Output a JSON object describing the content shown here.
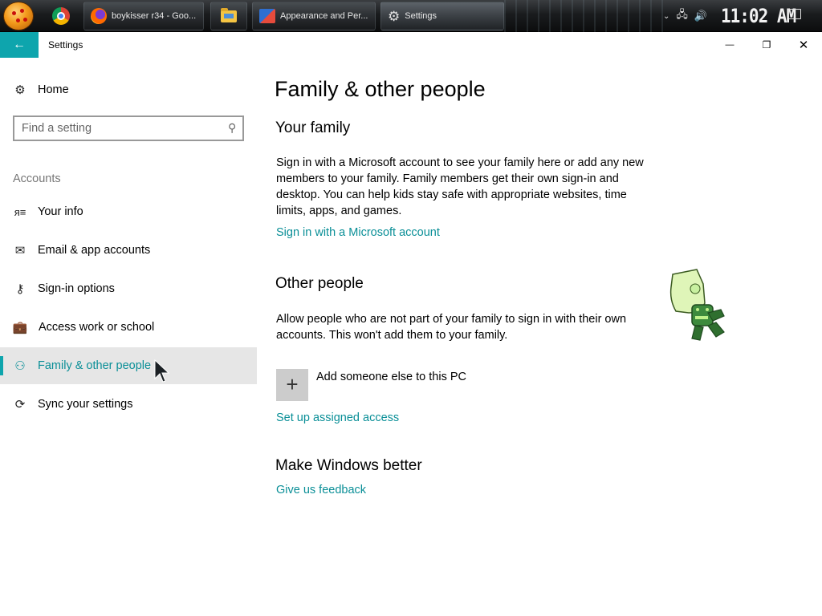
{
  "taskbar": {
    "windows": [
      {
        "label": "boykisser r34 - Goo...",
        "icon": "firefox-icon"
      },
      {
        "label": "",
        "icon": "file-explorer-icon"
      },
      {
        "label": "Appearance and Per...",
        "icon": "appearance-icon"
      },
      {
        "label": "Settings",
        "icon": "gear-icon"
      }
    ],
    "pinned": [
      {
        "icon": "chrome-icon"
      }
    ],
    "clock": "11:02 AM"
  },
  "titlebar": {
    "title": "Settings",
    "back_glyph": "←",
    "minimize_glyph": "—",
    "restore_glyph": "❐",
    "close_glyph": "✕"
  },
  "sidebar": {
    "home": {
      "label": "Home",
      "icon": "gear-icon"
    },
    "search": {
      "placeholder": "Find a setting"
    },
    "section": "Accounts",
    "items": [
      {
        "label": "Your info",
        "icon": "person-card-icon",
        "selected": false
      },
      {
        "label": "Email & app accounts",
        "icon": "mail-icon",
        "selected": false
      },
      {
        "label": "Sign-in options",
        "icon": "key-icon",
        "selected": false
      },
      {
        "label": "Access work or school",
        "icon": "briefcase-icon",
        "selected": false
      },
      {
        "label": "Family & other people",
        "icon": "person-add-icon",
        "selected": true
      },
      {
        "label": "Sync your settings",
        "icon": "sync-icon",
        "selected": false
      }
    ]
  },
  "main": {
    "title": "Family & other people",
    "your_family": {
      "heading": "Your family",
      "body": "Sign in with a Microsoft account to see your family here or add any new members to your family. Family members get their own sign-in and desktop. You can help kids stay safe with appropriate websites, time limits, apps, and games.",
      "link": "Sign in with a Microsoft account"
    },
    "other_people": {
      "heading": "Other people",
      "body": "Allow people who are not part of your family to sign in with their own accounts. This won't add them to your family.",
      "add_label": "Add someone else to this PC",
      "link": "Set up assigned access"
    },
    "feedback": {
      "heading": "Make Windows better",
      "link": "Give us feedback"
    }
  },
  "colors": {
    "accent": "#0ea5ad",
    "link": "#0a8f97",
    "selected_bg": "#e6e6e6"
  }
}
